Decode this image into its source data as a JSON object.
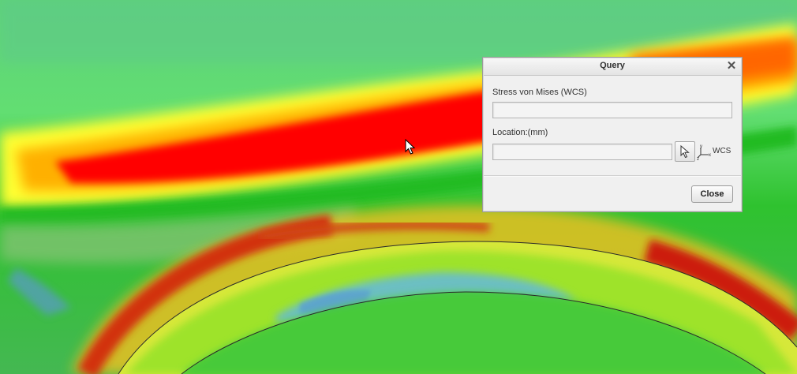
{
  "dialog": {
    "title": "Query",
    "stress_label": "Stress von Mises (WCS)",
    "stress_value": "",
    "location_label": "Location:(mm)",
    "location_value": "",
    "coord_system_label": "WCS",
    "close_label": "Close"
  },
  "icons": {
    "close": "close-icon",
    "pick": "cursor-pick-icon",
    "axes": "coordinate-axes-icon"
  },
  "colors": {
    "stress_high": "#ff0000",
    "stress_mid_high": "#ff9900",
    "stress_mid": "#ffff00",
    "stress_low": "#00cc00",
    "stress_min": "#66aacc",
    "dialog_bg": "#f0f0f0"
  }
}
